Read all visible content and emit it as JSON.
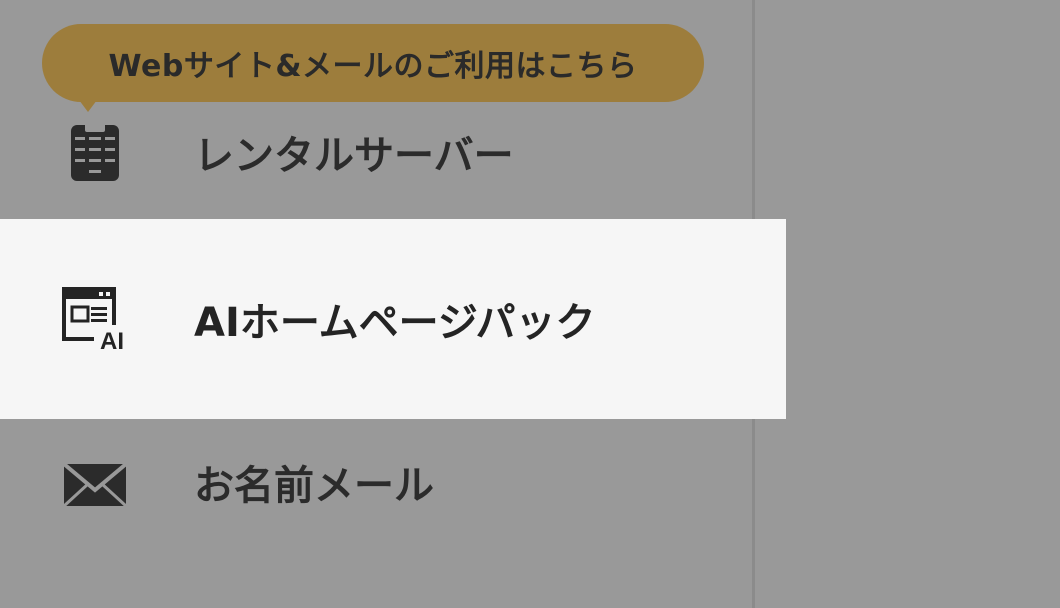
{
  "tooltip": {
    "text": "Webサイト&メールのご利用はこちら"
  },
  "menu": {
    "items": [
      {
        "label": "レンタルサーバー",
        "icon": "server-icon"
      },
      {
        "label": "AIホームページパック",
        "icon": "ai-homepage-icon"
      },
      {
        "label": "お名前メール",
        "icon": "mail-icon"
      }
    ]
  },
  "icons": {
    "ai_badge": "AI"
  },
  "colors": {
    "overlay_background": "#999999",
    "tooltip_background": "#9d7d3c",
    "active_item_background": "#f6f6f6",
    "text": "#2b2b2b"
  }
}
